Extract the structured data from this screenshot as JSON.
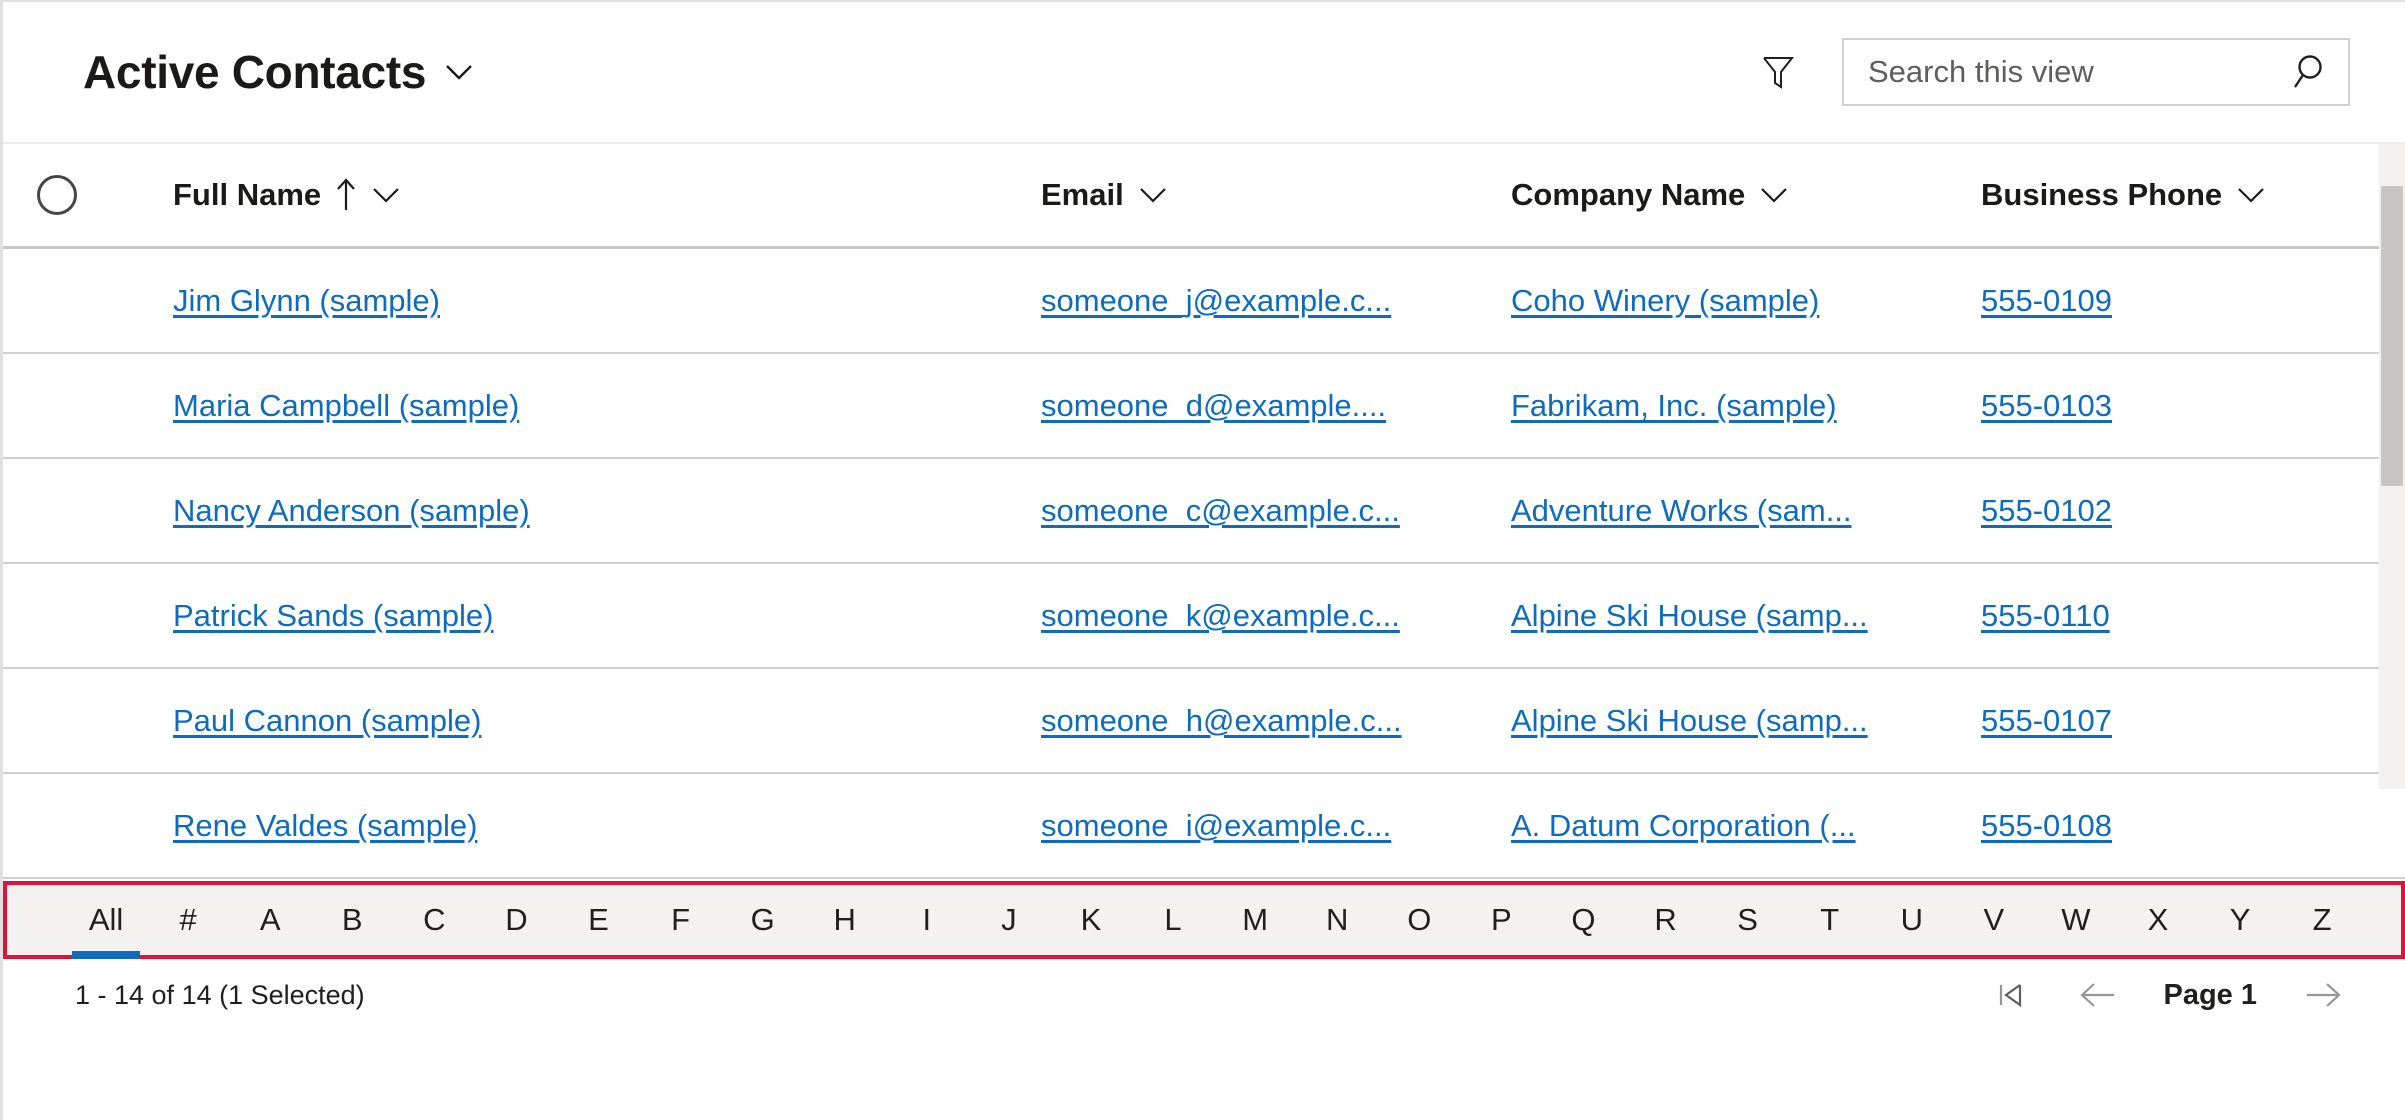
{
  "header": {
    "view_title": "Active Contacts",
    "view_chevron_icon": "chevron-down-icon",
    "filter_icon": "filter-icon",
    "search_placeholder": "Search this view",
    "search_value": "",
    "search_icon": "search-icon"
  },
  "grid": {
    "select_all_icon": "select-all-circle-icon",
    "columns": [
      {
        "label": "Full Name",
        "sort": "ascending",
        "sort_icon": "arrow-up-icon",
        "menu_icon": "chevron-down-icon"
      },
      {
        "label": "Email",
        "sort": "none",
        "menu_icon": "chevron-down-icon"
      },
      {
        "label": "Company Name",
        "sort": "none",
        "menu_icon": "chevron-down-icon"
      },
      {
        "label": "Business Phone",
        "sort": "none",
        "menu_icon": "chevron-down-icon"
      }
    ],
    "rows": [
      {
        "full_name": "Jim Glynn (sample)",
        "email": "someone_j@example.c...",
        "company": "Coho Winery (sample)",
        "phone": "555-0109"
      },
      {
        "full_name": "Maria Campbell (sample)",
        "email": "someone_d@example....",
        "company": "Fabrikam, Inc. (sample)",
        "phone": "555-0103"
      },
      {
        "full_name": "Nancy Anderson (sample)",
        "email": "someone_c@example.c...",
        "company": "Adventure Works (sam...",
        "phone": "555-0102"
      },
      {
        "full_name": "Patrick Sands (sample)",
        "email": "someone_k@example.c...",
        "company": "Alpine Ski House (samp...",
        "phone": "555-0110"
      },
      {
        "full_name": "Paul Cannon (sample)",
        "email": "someone_h@example.c...",
        "company": "Alpine Ski House (samp...",
        "phone": "555-0107"
      },
      {
        "full_name": "Rene Valdes (sample)",
        "email": "someone_i@example.c...",
        "company": "A. Datum Corporation (...",
        "phone": "555-0108"
      }
    ]
  },
  "alpha_filter": {
    "highlight_color": "#e0113a",
    "selected": "All",
    "items": [
      "All",
      "#",
      "A",
      "B",
      "C",
      "D",
      "E",
      "F",
      "G",
      "H",
      "I",
      "J",
      "K",
      "L",
      "M",
      "N",
      "O",
      "P",
      "Q",
      "R",
      "S",
      "T",
      "U",
      "V",
      "W",
      "X",
      "Y",
      "Z"
    ]
  },
  "footer": {
    "record_count": "1 - 14 of 14 (1 Selected)",
    "page_label": "Page 1",
    "first_page_icon": "first-page-icon",
    "previous_page_icon": "arrow-left-icon",
    "next_page_icon": "arrow-right-icon"
  }
}
